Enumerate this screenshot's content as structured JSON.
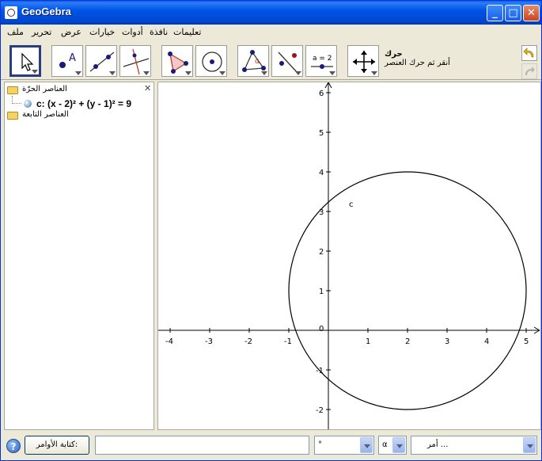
{
  "window": {
    "title": "GeoGebra"
  },
  "menu": [
    "ملف",
    "تحرير",
    "عرض",
    "خيارات",
    "أدوات",
    "نافذة",
    "تعليمات"
  ],
  "toolbar": {
    "tool_name": "حرك",
    "tool_help": "أنقر ثم حرك العنصر",
    "slider_label": "a = 2"
  },
  "algebra": {
    "free_objects": "العناصر الحرّة",
    "dependent_objects": "العناصر التابعة",
    "equation": "c: (x - 2)² + (y - 1)² = 9"
  },
  "graphics": {
    "curve_label": "c",
    "x_ticks": [
      "-4",
      "-3",
      "-2",
      "-1",
      "0",
      "1",
      "2",
      "3",
      "4",
      "5"
    ],
    "y_ticks": [
      "-2",
      "-1",
      "1",
      "2",
      "3",
      "4",
      "5",
      "6"
    ],
    "origin_label": "0"
  },
  "inputbar": {
    "button_label": "كتابة الأوامر:",
    "symbol1": "°",
    "symbol2": "α",
    "command_placeholder": "أمر ..."
  }
}
